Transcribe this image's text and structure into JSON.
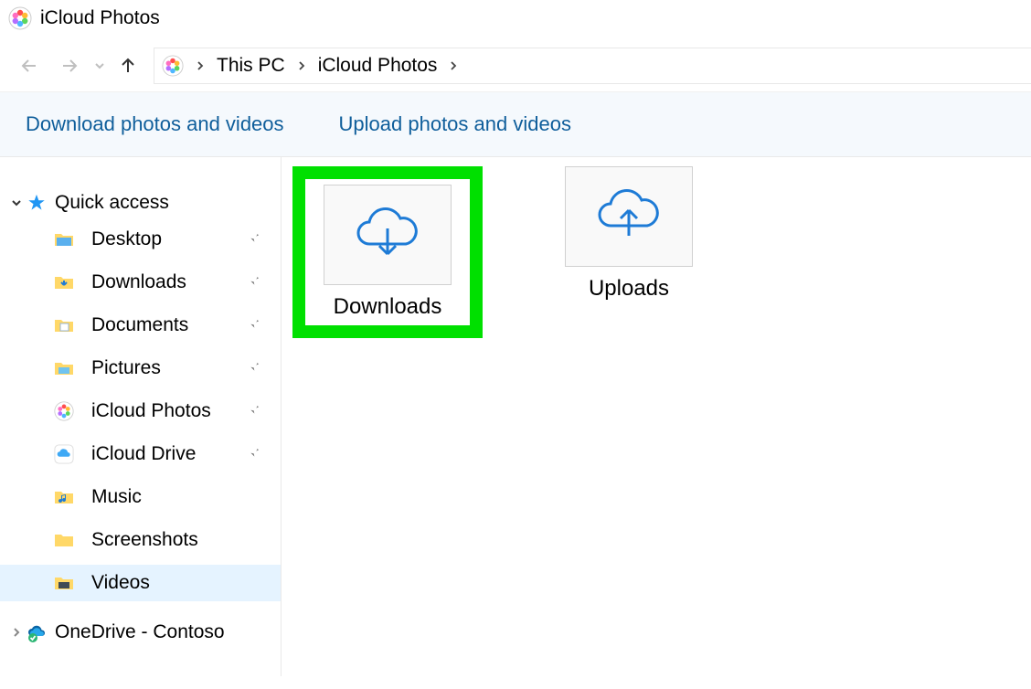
{
  "window": {
    "title": "iCloud Photos"
  },
  "breadcrumb": {
    "items": [
      "This PC",
      "iCloud Photos"
    ]
  },
  "actions": {
    "download": "Download photos and videos",
    "upload": "Upload photos and videos"
  },
  "sidebar": {
    "quick_access": {
      "label": "Quick access",
      "items": [
        {
          "label": "Desktop",
          "pinned": true,
          "icon": "desktop"
        },
        {
          "label": "Downloads",
          "pinned": true,
          "icon": "downloads"
        },
        {
          "label": "Documents",
          "pinned": true,
          "icon": "documents"
        },
        {
          "label": "Pictures",
          "pinned": true,
          "icon": "pictures"
        },
        {
          "label": "iCloud Photos",
          "pinned": true,
          "icon": "icloud-photos"
        },
        {
          "label": "iCloud Drive",
          "pinned": true,
          "icon": "icloud-drive"
        },
        {
          "label": "Music",
          "pinned": false,
          "icon": "music"
        },
        {
          "label": "Screenshots",
          "pinned": false,
          "icon": "folder"
        },
        {
          "label": "Videos",
          "pinned": false,
          "icon": "videos",
          "selected": true
        }
      ]
    },
    "onedrive": {
      "label": "OneDrive - Contoso"
    }
  },
  "content": {
    "folders": [
      {
        "label": "Downloads",
        "icon": "cloud-down",
        "highlighted": true
      },
      {
        "label": "Uploads",
        "icon": "cloud-up",
        "highlighted": false
      }
    ]
  }
}
